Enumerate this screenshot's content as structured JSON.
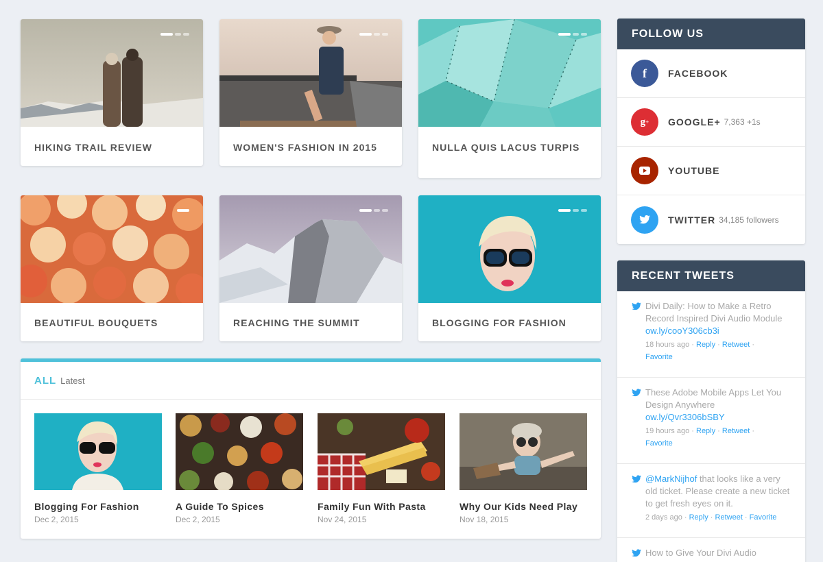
{
  "cards": [
    {
      "title": "HIKING TRAIL REVIEW"
    },
    {
      "title": "WOMEN'S FASHION IN 2015"
    },
    {
      "title": "NULLA QUIS LACUS TURPIS"
    },
    {
      "title": "BEAUTIFUL BOUQUETS"
    },
    {
      "title": "REACHING THE SUMMIT"
    },
    {
      "title": "BLOGGING FOR FASHION"
    }
  ],
  "follow": {
    "heading": "FOLLOW US",
    "items": [
      {
        "name": "FACEBOOK",
        "extra": "",
        "icon": "facebook-icon",
        "color": "#3b5998"
      },
      {
        "name": "GOOGLE+",
        "extra": "7,363 +1s",
        "icon": "google-plus-icon",
        "color": "#dd2e34"
      },
      {
        "name": "YOUTUBE",
        "extra": "",
        "icon": "youtube-icon",
        "color": "#a82400"
      },
      {
        "name": "TWITTER",
        "extra": "34,185 followers",
        "icon": "twitter-icon",
        "color": "#2ea3f2"
      }
    ]
  },
  "tweets": {
    "heading": "RECENT TWEETS",
    "items": [
      {
        "text": "Divi Daily: How to Make a Retro Record Inspired Divi Audio Module ",
        "link": "ow.ly/cooY306cb3i",
        "time": "18 hours ago",
        "reply": "Reply",
        "retweet": "Retweet",
        "favorite": "Favorite"
      },
      {
        "text": "These Adobe Mobile Apps Let You Design Anywhere ",
        "link": "ow.ly/Qvr3306bSBY",
        "time": "19 hours ago",
        "reply": "Reply",
        "retweet": "Retweet",
        "favorite": "Favorite"
      },
      {
        "mention": "@MarkNijhof",
        "text": " that looks like a very old ticket. Please create a new ticket to get fresh eyes on it.",
        "time": "2 days ago",
        "reply": "Reply",
        "retweet": "Retweet",
        "favorite": "Favorite"
      },
      {
        "text": "How to Give Your Divi Audio"
      }
    ]
  },
  "latest": {
    "all_label": "ALL",
    "latest_label": "Latest",
    "posts": [
      {
        "title": "Blogging For Fashion",
        "date": "Dec 2, 2015"
      },
      {
        "title": "A Guide To Spices",
        "date": "Dec 2, 2015"
      },
      {
        "title": "Family Fun With Pasta",
        "date": "Nov 24, 2015"
      },
      {
        "title": "Why Our Kids Need Play",
        "date": "Nov 18, 2015"
      }
    ]
  }
}
